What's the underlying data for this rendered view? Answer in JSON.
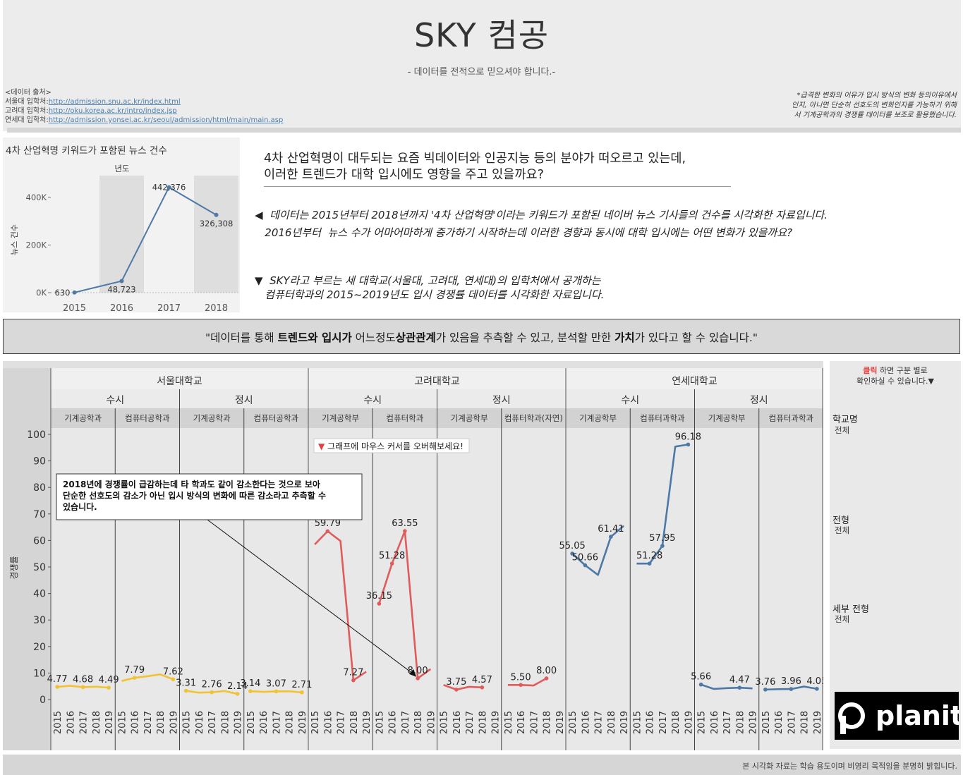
{
  "header": {
    "title": "SKY 컴공",
    "subtitle": "- 데이터를 전적으로 믿으셔야 합니다.-",
    "sources_heading": "<데이터 출처>",
    "sources": [
      {
        "label": "서울대 입학처:",
        "url": "http://admission.snu.ac.kr/index.html"
      },
      {
        "label": "고려대 입학처:",
        "url": "http://oku.korea.ac.kr/intro/index.jsp"
      },
      {
        "label": "연세대 입학처:",
        "url": "http://admission.yonsei.ac.kr/seoul/admission/html/main/main.asp"
      }
    ],
    "note_lines": [
      "*급격한 변화의 이유가 입시 방식의 변화 등의이유에서",
      "인지, 아니면 단순히 선호도의 변화인지를 가능하기 위해",
      "서  기계공학과의 경쟁률 데이터를 보조로 활용했습니다."
    ]
  },
  "intro": {
    "question_line1": "4차 산업혁명이 대두되는 요즘 빅데이터와 인공지능 등의 분야가 떠오르고 있는데,",
    "question_line2": "이러한 트렌드가 대학 입시에도 영향을 주고 있을까요?",
    "desc1_line1": "◀  데이터는 2015년부터 2018년까지 '4차 산업혁명'이라는 키워드가 포함된 네이버 뉴스 기사들의 건수를 시각화한 자료입니다.",
    "desc1_line2": "   2016년부터  뉴스 수가 어마어마하게 증가하기 시작하는데 이러한 경향과 동시에 대학 입시에는 어떤 변화가 있을까요?",
    "desc2_line1": "▼  SKY라고 부르는 세 대학교(서울대, 고려대, 연세대)의 입학처에서 공개하는",
    "desc2_line2": "   컴퓨터학과의 2015~2019년도 입시 경쟁률 데이터를 시각화한 자료입니다."
  },
  "banner": {
    "pre": "\"데이터를 통해 ",
    "b1": "트렌드와 입시가",
    "mid1": " 어느정도",
    "b2": "상관관계",
    "mid2": "가 있음을 추측할 수 있고, 분석할 만한  ",
    "b3": "가치",
    "post": "가 있다고 할 수 있습니다.\""
  },
  "filters": {
    "hint_click": "클릭",
    "hint_rest": "하면 구분 별로",
    "hint_line2": "확인하실 수 있습니다.▼",
    "items": [
      {
        "label": "학교명",
        "value": "전체"
      },
      {
        "label": "전형",
        "value": "전체"
      },
      {
        "label": "세부 전형",
        "value": "전체"
      }
    ],
    "logo_text": "planit"
  },
  "footer": {
    "text": "본 시각화 자료는 학습 용도이며 비영리 목적임을 분명히 밝힙니다."
  },
  "colors": {
    "seoul": "#f1c232",
    "korea": "#e05c5c",
    "yonsei": "#4e79a7",
    "news_line": "#4e79a7"
  },
  "chart_data": [
    {
      "type": "line",
      "title": "4차 산업혁명 키워드가 포함된 뉴스 건수",
      "xlabel": "년도",
      "ylabel": "뉴스 건수",
      "categories": [
        "2015",
        "2016",
        "2017",
        "2018"
      ],
      "values": [
        630,
        48723,
        442376,
        326308
      ],
      "value_labels": [
        "630",
        "48,723",
        "442,376",
        "326,308"
      ],
      "ylim": [
        0,
        450000
      ],
      "yticks": [
        "0K",
        "200K",
        "400K"
      ],
      "banded_columns": true
    },
    {
      "type": "line",
      "ylabel": "경쟁률",
      "ylim": [
        0,
        100
      ],
      "yticks": [
        0,
        10,
        20,
        30,
        40,
        50,
        60,
        70,
        80,
        90,
        100
      ],
      "x": [
        "2015",
        "2016",
        "2017",
        "2018",
        "2019"
      ],
      "hover_hint": "▼ 그래프에 마우스 커서를 오버해보세요!",
      "annotation": {
        "lines": [
          "2018년에 경쟁률이 급감하는데 타 학과도 같이 감소한다는 것으로 보아",
          "단순한 선호도의 감소가 아닌 입시 방식의 변화에 따른 감소라고 추측할 수",
          "있습니다."
        ],
        "target_panel": 5,
        "target_year_index": 3
      },
      "universities": [
        {
          "name": "서울대학교",
          "color_key": "seoul",
          "types": [
            {
              "name": "수시",
              "depts": [
                {
                  "name": "기계공학과",
                  "values": [
                    4.77,
                    5.2,
                    4.68,
                    4.85,
                    4.49
                  ],
                  "labels": [
                    [
                      0,
                      "4.77"
                    ],
                    [
                      2,
                      "4.68"
                    ],
                    [
                      4,
                      "4.49"
                    ]
                  ]
                },
                {
                  "name": "컴퓨터공학과",
                  "values": [
                    7.0,
                    8.2,
                    8.8,
                    9.5,
                    7.62
                  ],
                  "labels": [
                    [
                      1,
                      "7.79"
                    ],
                    [
                      4,
                      "7.62"
                    ]
                  ]
                }
              ]
            },
            {
              "name": "정시",
              "depts": [
                {
                  "name": "기계공학과",
                  "values": [
                    3.31,
                    2.6,
                    2.76,
                    3.2,
                    2.14
                  ],
                  "labels": [
                    [
                      0,
                      "3.31"
                    ],
                    [
                      2,
                      "2.76"
                    ],
                    [
                      4,
                      "2.14"
                    ]
                  ]
                },
                {
                  "name": "컴퓨터공학과",
                  "values": [
                    3.14,
                    2.9,
                    3.07,
                    3.1,
                    2.71
                  ],
                  "labels": [
                    [
                      0,
                      "3.14"
                    ],
                    [
                      2,
                      "3.07"
                    ],
                    [
                      4,
                      "2.71"
                    ]
                  ]
                }
              ]
            }
          ]
        },
        {
          "name": "고려대학교",
          "color_key": "korea",
          "types": [
            {
              "name": "수시",
              "depts": [
                {
                  "name": "기계공학부",
                  "values": [
                    58.5,
                    63.5,
                    59.79,
                    7.27,
                    10.5
                  ],
                  "labels": [
                    [
                      1,
                      "59.79"
                    ],
                    [
                      3,
                      "7.27"
                    ]
                  ]
                },
                {
                  "name": "컴퓨터학과",
                  "values": [
                    36.15,
                    51.28,
                    63.55,
                    8.0,
                    11.5
                  ],
                  "labels": [
                    [
                      0,
                      "36.15"
                    ],
                    [
                      1,
                      "51.28"
                    ],
                    [
                      2,
                      "63.55"
                    ],
                    [
                      3,
                      "8.00"
                    ]
                  ]
                }
              ]
            },
            {
              "name": "정시",
              "depts": [
                {
                  "name": "기계공학부",
                  "values": [
                    5.5,
                    3.75,
                    4.8,
                    4.57,
                    null
                  ],
                  "labels": [
                    [
                      1,
                      "3.75"
                    ],
                    [
                      3,
                      "4.57"
                    ]
                  ]
                },
                {
                  "name": "컴퓨터학과(자연)",
                  "values": [
                    5.5,
                    5.5,
                    5.3,
                    8.0,
                    null
                  ],
                  "labels": [
                    [
                      1,
                      "5.50"
                    ],
                    [
                      3,
                      "8.00"
                    ]
                  ]
                }
              ]
            }
          ]
        },
        {
          "name": "연세대학교",
          "color_key": "yonsei",
          "types": [
            {
              "name": "수시",
              "depts": [
                {
                  "name": "기계공학부",
                  "values": [
                    55.05,
                    50.66,
                    47.0,
                    61.41,
                    65.5
                  ],
                  "labels": [
                    [
                      0,
                      "55.05"
                    ],
                    [
                      1,
                      "50.66"
                    ],
                    [
                      3,
                      "61.41"
                    ]
                  ]
                },
                {
                  "name": "컴퓨터과학과",
                  "values": [
                    51.28,
                    51.28,
                    57.95,
                    95.4,
                    96.18
                  ],
                  "labels": [
                    [
                      1,
                      "51.28"
                    ],
                    [
                      2,
                      "57.95"
                    ],
                    [
                      4,
                      "96.18"
                    ]
                  ]
                }
              ]
            },
            {
              "name": "정시",
              "depts": [
                {
                  "name": "기계공학부",
                  "values": [
                    5.66,
                    4.0,
                    4.3,
                    4.47,
                    4.2
                  ],
                  "labels": [
                    [
                      0,
                      "5.66"
                    ],
                    [
                      3,
                      "4.47"
                    ]
                  ]
                },
                {
                  "name": "컴퓨터과학과",
                  "values": [
                    3.76,
                    3.9,
                    3.96,
                    4.9,
                    4.05
                  ],
                  "labels": [
                    [
                      0,
                      "3.76"
                    ],
                    [
                      2,
                      "3.96"
                    ],
                    [
                      4,
                      "4.05"
                    ]
                  ]
                }
              ]
            }
          ]
        }
      ]
    }
  ]
}
